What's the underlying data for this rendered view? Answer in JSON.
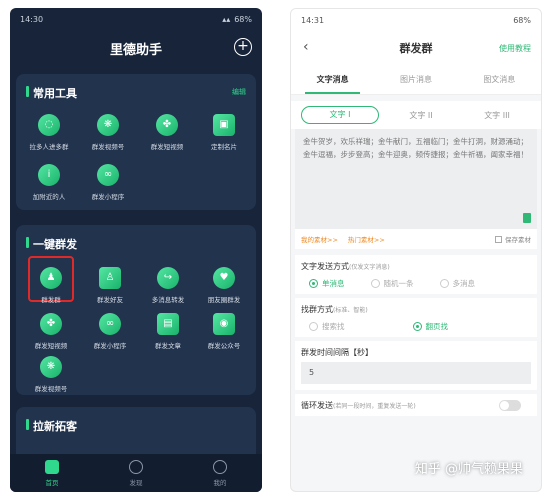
{
  "left": {
    "status": {
      "time": "14:30",
      "battery": "68%"
    },
    "title": "里德助手",
    "tools": {
      "title": "常用工具",
      "edit": "编辑",
      "items": [
        "拉多人进多群",
        "群发视频号",
        "群发短视频",
        "定制名片",
        "加附近的人",
        "群发小程序"
      ]
    },
    "group": {
      "title": "一键群发",
      "items": [
        "群发群",
        "群发好友",
        "多消息转发",
        "朋友圈群发",
        "群发短视频",
        "群发小程序",
        "群发文章",
        "群发公众号",
        "群发视频号"
      ]
    },
    "lead": {
      "title": "拉新拓客"
    },
    "nav": [
      "首页",
      "发现",
      "我的"
    ]
  },
  "right": {
    "status": {
      "time": "14:31",
      "battery": "68%"
    },
    "title": "群发群",
    "help": "使用教程",
    "tabs": [
      "文字消息",
      "图片消息",
      "图文消息"
    ],
    "subtabs": [
      "文字 I",
      "文字 II",
      "文字 III"
    ],
    "message": "金牛贺岁，欢乐祥瑞；金牛献门，五福临门；金牛打洞，财源涌动；金牛逗福，步步登高；金牛迎奥，频传捷报；金牛祈福，阖家幸福！",
    "my_material": "我的素材>>",
    "hot_material": "热门素材>>",
    "save_material": "保存素材",
    "send_mode": {
      "label": "文字发送方式",
      "hint": "(仅发文字消息)",
      "options": [
        "单消息",
        "随机一条",
        "多消息"
      ]
    },
    "find_mode": {
      "label": "找群方式",
      "hint": "(标准、智能)",
      "options": [
        "搜索找",
        "翻页找"
      ]
    },
    "interval": {
      "label": "群发时间间隔【秒】",
      "value": "5"
    },
    "loop": {
      "label": "循环发送",
      "hint": "(若同一段时间，重复发送一轮)"
    },
    "watermark": "知乎 @帅气赖果果"
  }
}
